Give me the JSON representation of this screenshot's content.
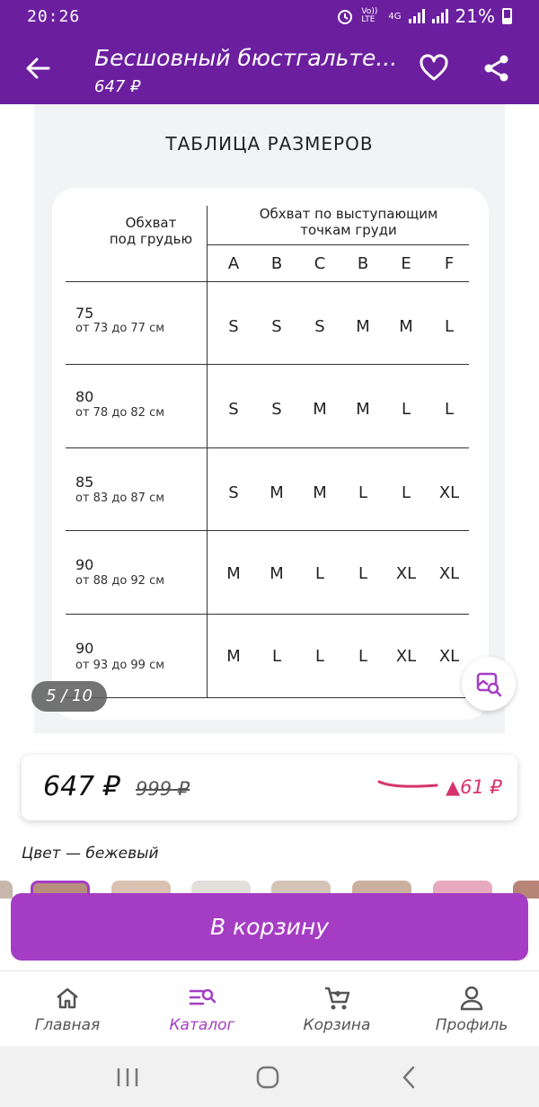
{
  "status_bar": {
    "time": "20:26",
    "network": "Vo)) LTE",
    "network_type": "4G",
    "battery_percent": "21%"
  },
  "app_bar": {
    "title": "Бесшовный бюстгальте...",
    "subtitle": "647 ₽",
    "back_icon": "arrow-back-icon",
    "favorite_icon": "heart-icon",
    "share_icon": "share-icon"
  },
  "size_table": {
    "title": "ТАБЛИЦА РАЗМЕРОВ",
    "left_header": "Обхват\nпод грудью",
    "right_header": "Обхват по выступающим\nточкам груди",
    "cups": [
      "A",
      "B",
      "C",
      "B",
      "E",
      "F"
    ],
    "rows": [
      {
        "band": "75",
        "range": "от 73 до 77 см",
        "sizes": [
          "S",
          "S",
          "S",
          "M",
          "M",
          "L"
        ]
      },
      {
        "band": "80",
        "range": "от 78 до 82 см",
        "sizes": [
          "S",
          "S",
          "M",
          "M",
          "L",
          "L"
        ]
      },
      {
        "band": "85",
        "range": "от 83 до 87 см",
        "sizes": [
          "S",
          "M",
          "M",
          "L",
          "L",
          "XL"
        ]
      },
      {
        "band": "90",
        "range": "от 88 до 92 см",
        "sizes": [
          "M",
          "M",
          "L",
          "L",
          "XL",
          "XL"
        ]
      },
      {
        "band": "90",
        "range": "от 93 до 99 см",
        "sizes": [
          "M",
          "L",
          "L",
          "L",
          "XL",
          "XL"
        ]
      }
    ]
  },
  "gallery": {
    "counter": "5 / 10"
  },
  "price_card": {
    "price": "647 ₽",
    "old_price": "999 ₽",
    "delta": "▲61 ₽"
  },
  "color": {
    "label": "Цвет — бежевый",
    "thumb_count": 7
  },
  "cart_button": {
    "label": "В корзину"
  },
  "bottom_nav": {
    "items": [
      {
        "label": "Главная",
        "icon": "home-icon",
        "active": false
      },
      {
        "label": "Каталог",
        "icon": "catalog-search-icon",
        "active": true
      },
      {
        "label": "Корзина",
        "icon": "cart-icon",
        "active": false
      },
      {
        "label": "Профиль",
        "icon": "profile-icon",
        "active": false
      }
    ]
  },
  "colors": {
    "brand": "#6b1f9f",
    "accent": "#a53dc4",
    "delta": "#d6336c"
  }
}
